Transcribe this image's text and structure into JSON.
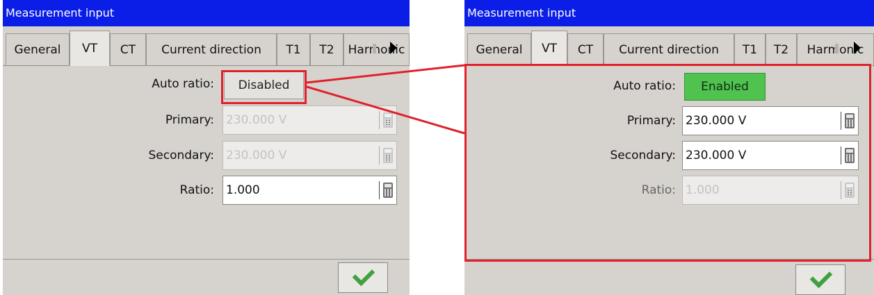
{
  "left_panel": {
    "title": "Measurement input",
    "tabs": [
      "General",
      "VT",
      "CT",
      "Current direction",
      "T1",
      "T2",
      "Harmonic"
    ],
    "active_tab": "VT",
    "auto_ratio": {
      "label": "Auto ratio:",
      "value": "Disabled"
    },
    "primary": {
      "label": "Primary:",
      "value": "230.000 V",
      "disabled": true
    },
    "secondary": {
      "label": "Secondary:",
      "value": "230.000 V",
      "disabled": true
    },
    "ratio": {
      "label": "Ratio:",
      "value": "1.000",
      "disabled": false
    }
  },
  "right_panel": {
    "title": "Measurement input",
    "tabs": [
      "General",
      "VT",
      "CT",
      "Current direction",
      "T1",
      "T2",
      "Harmonic"
    ],
    "active_tab": "VT",
    "auto_ratio": {
      "label": "Auto ratio:",
      "value": "Enabled"
    },
    "primary": {
      "label": "Primary:",
      "value": "230.000 V",
      "disabled": false
    },
    "secondary": {
      "label": "Secondary:",
      "value": "230.000 V",
      "disabled": false
    },
    "ratio": {
      "label": "Ratio:",
      "value": "1.000",
      "disabled": true
    }
  },
  "colors": {
    "title_bar": "#0b1ee8",
    "highlight": "#e0202a",
    "enabled_button": "#4fc24f",
    "panel_bg": "#d6d3ce"
  },
  "icons": [
    "calculator-icon",
    "checkmark-icon",
    "scroll-right-arrow-icon"
  ]
}
